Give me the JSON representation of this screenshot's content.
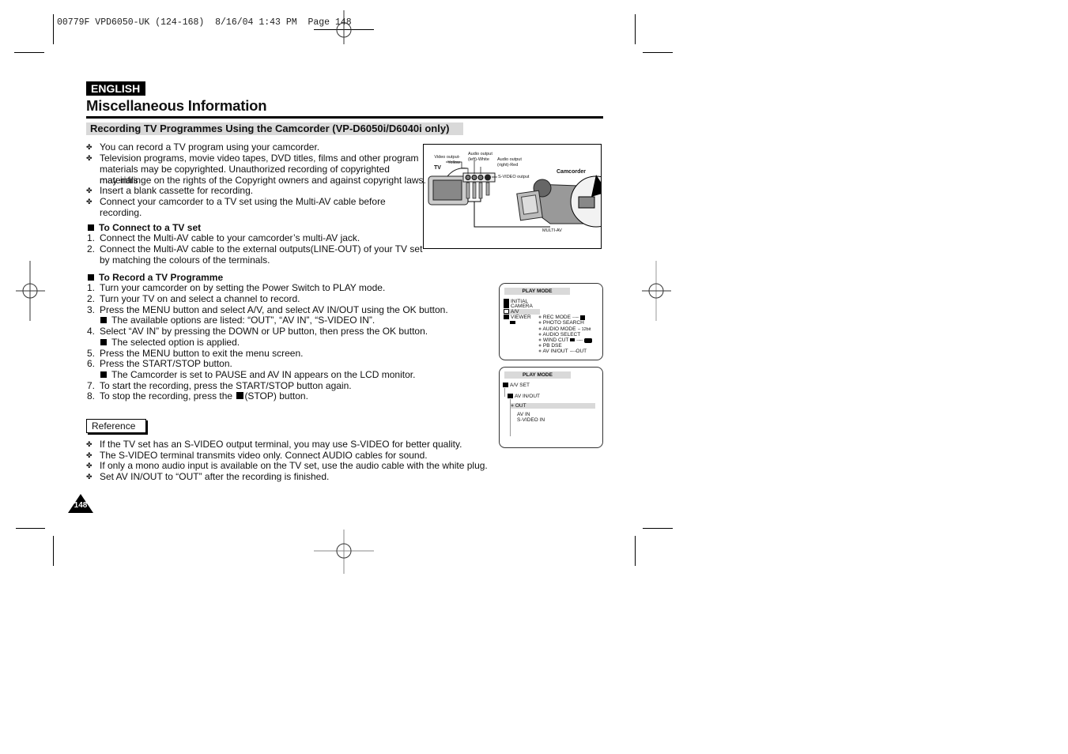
{
  "slug": "00779F VPD6050-UK (124-168)  8/16/04 1:43 PM  Page 148",
  "language_badge": "ENGLISH",
  "page_title": "Miscellaneous Information",
  "section_title": "Recording TV Programmes Using the Camcorder (VP-D6050i/D6040i only)",
  "intro_bullets": [
    "You can record a TV program using your camcorder.",
    "Television programs, movie video tapes, DVD titles, films and other program",
    "materials may be copyrighted. Unauthorized recording of copyrighted materials",
    "may infringe on the rights of the Copyright owners and against copyright laws.",
    "Insert a blank cassette for recording.",
    "Connect your camcorder to a TV set using the Multi-AV cable before recording."
  ],
  "connect": {
    "heading": "To Connect to a TV set",
    "steps": [
      {
        "n": "1.",
        "text": "Connect the Multi-AV cable to your camcorder’s multi-AV jack."
      },
      {
        "n": "2.",
        "text": "Connect the Multi-AV cable to the external outputs(LINE-OUT) of your TV set"
      },
      {
        "n": "",
        "text": "by matching the colours of the terminals."
      }
    ]
  },
  "record": {
    "heading": "To Record a TV Programme",
    "steps": [
      {
        "n": "1.",
        "text": "Turn your camcorder on by setting the Power Switch to PLAY mode."
      },
      {
        "n": "2.",
        "text": "Turn your TV on and select a channel to record."
      },
      {
        "n": "3.",
        "text": "Press the MENU button and select A/V, and select AV IN/OUT using the OK button."
      },
      {
        "n": "4.",
        "text": "Select “AV IN” by pressing the DOWN or UP button, then press the OK button."
      },
      {
        "n": "5.",
        "text": "Press the MENU button to exit the menu screen."
      },
      {
        "n": "6.",
        "text": "Press the START/STOP button."
      },
      {
        "n": "7.",
        "text": "To start the recording, press the START/STOP button again."
      },
      {
        "n": "8.",
        "text": "To stop the recording, press the",
        "suffix": "(STOP) button."
      }
    ],
    "notes": {
      "after_3": "The available options are listed: “OUT”, “AV IN”, “S-VIDEO IN”.",
      "after_4": "The selected option is applied.",
      "after_6": "The Camcorder is set to PAUSE and AV IN appears on the LCD monitor."
    }
  },
  "reference": {
    "label": "Reference",
    "bullets": [
      "If the TV set has an S-VIDEO output terminal, you may use S-VIDEO for better quality.",
      "The S-VIDEO terminal transmits video only. Connect AUDIO cables for sound.",
      "If only a mono audio input is available on the TV set, use the audio cable with the white plug.",
      "Set AV IN/OUT to “OUT” after the recording is finished."
    ]
  },
  "diagram": {
    "tv_label": "TV",
    "video_output": "Video output-",
    "video_output_color": "Yellow",
    "audio_left": "Audio output",
    "audio_left_color": "(left)-White",
    "audio_right": "Audio output",
    "audio_right_color": "(right)-Red",
    "svideo": "S-VIDEO output",
    "camcorder_label": "Camcorder",
    "multi_av": "MULTI-AV"
  },
  "menu1": {
    "title": "PLAY MODE",
    "left": [
      "INITIAL",
      "CAMERA",
      "A/V",
      "VIEWER"
    ],
    "right": [
      {
        "label": "REC MODE",
        "value": "SP"
      },
      {
        "label": "PHOTO SEARCH",
        "value": ""
      },
      {
        "label": "AUDIO MODE",
        "value": "12bit"
      },
      {
        "label": "AUDIO SELECT",
        "value": ""
      },
      {
        "label": "WIND CUT",
        "value": "OFF"
      },
      {
        "label": "PB DSE",
        "value": ""
      },
      {
        "label": "AV IN/OUT",
        "value": "OUT"
      }
    ]
  },
  "menu2": {
    "title": "PLAY MODE",
    "root": "A/V SET",
    "sub": "AV IN/OUT",
    "options": [
      "OUT",
      "AV IN",
      "S-VIDEO IN"
    ],
    "selected": "OUT"
  },
  "page_number": "148"
}
